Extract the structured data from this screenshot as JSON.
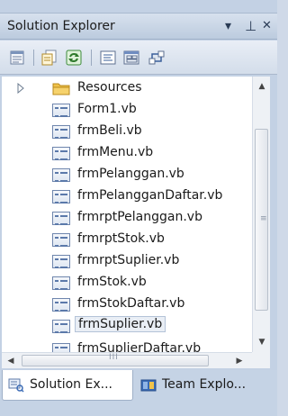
{
  "panel": {
    "title": "Solution Explorer",
    "dropdown_glyph": "▾",
    "pin_glyph": "⊥",
    "close_glyph": "✕"
  },
  "toolbar": {
    "buttons": [
      {
        "icon": "properties-icon"
      },
      {
        "icon": "show-all-files-icon"
      },
      {
        "icon": "refresh-icon"
      },
      {
        "icon": "view-code-icon"
      },
      {
        "icon": "view-designer-icon"
      },
      {
        "icon": "class-diagram-icon"
      }
    ]
  },
  "tree": {
    "items": [
      {
        "label": "Resources",
        "type": "folder",
        "expandable": true
      },
      {
        "label": "Form1.vb",
        "type": "form"
      },
      {
        "label": "frmBeli.vb",
        "type": "form"
      },
      {
        "label": "frmMenu.vb",
        "type": "form"
      },
      {
        "label": "frmPelanggan.vb",
        "type": "form"
      },
      {
        "label": "frmPelangganDaftar.vb",
        "type": "form"
      },
      {
        "label": "frmrptPelanggan.vb",
        "type": "form"
      },
      {
        "label": "frmrptStok.vb",
        "type": "form"
      },
      {
        "label": "frmrptSuplier.vb",
        "type": "form"
      },
      {
        "label": "frmStok.vb",
        "type": "form"
      },
      {
        "label": "frmStokDaftar.vb",
        "type": "form"
      },
      {
        "label": "frmSuplier.vb",
        "type": "form",
        "selected": true
      },
      {
        "label": "frmSuplierDaftar.vb",
        "type": "form",
        "partial": true
      }
    ]
  },
  "scrollbars": {
    "up": "▲",
    "down": "▼",
    "left": "◀",
    "right": "▶",
    "grip_h": "III"
  },
  "tabs": [
    {
      "label": "Solution Ex...",
      "icon": "solution-explorer-icon",
      "active": true
    },
    {
      "label": "Team Explo...",
      "icon": "team-explorer-icon",
      "active": false
    }
  ],
  "colors": {
    "chrome": "#c3d1e4",
    "folder": "#f0c24a",
    "accent": "#3a6bb5"
  }
}
